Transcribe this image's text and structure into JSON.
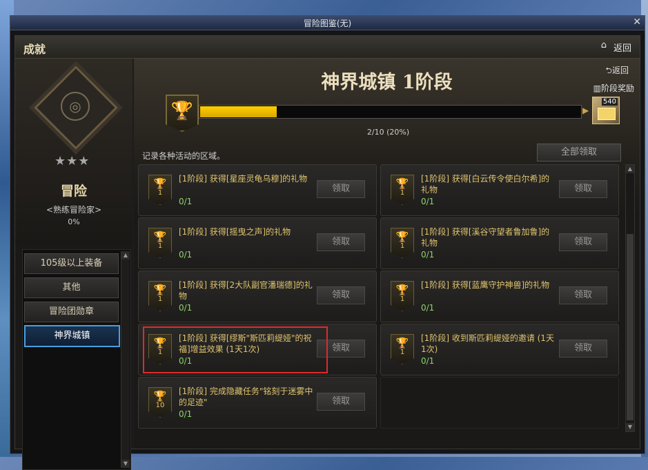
{
  "window": {
    "title": "冒险图鉴(无)",
    "close": "✕"
  },
  "header": {
    "title": "成就",
    "home": "⌂",
    "back": "返回"
  },
  "left": {
    "stars": "★★★",
    "name": "冒险",
    "rank": "<熟练冒险家>",
    "percent": "0%",
    "categories": [
      {
        "label": "105级以上装备",
        "active": false
      },
      {
        "label": "其他",
        "active": false
      },
      {
        "label": "冒险团勋章",
        "active": false
      },
      {
        "label": "神界城镇",
        "active": true
      }
    ]
  },
  "main": {
    "title": "神界城镇 1阶段",
    "return_label": "⮌返回",
    "stage_reward_label": "阶段奖励",
    "progress_text": "2/10 (20%)",
    "progress_fraction": 0.2,
    "reward_count": "540",
    "description": "记录各种活动的区域。",
    "claim_all": "全部领取",
    "cards": [
      {
        "text": "[1阶段] 获得[星座灵龟乌穆]的礼物",
        "progress": "0/1",
        "badge_num": "1",
        "button": "领取"
      },
      {
        "text": "[1阶段] 获得[白云传令使白尔希]的礼物",
        "progress": "0/1",
        "badge_num": "1",
        "button": "领取"
      },
      {
        "text": "[1阶段] 获得[摇曳之声]的礼物",
        "progress": "0/1",
        "badge_num": "1",
        "button": "领取"
      },
      {
        "text": "[1阶段] 获得[溪谷守望者鲁加鲁]的礼物",
        "progress": "0/1",
        "badge_num": "1",
        "button": "领取"
      },
      {
        "text": "[1阶段] 获得[2大队副官潘瑞德]的礼物",
        "progress": "0/1",
        "badge_num": "1",
        "button": "领取"
      },
      {
        "text": "[1阶段] 获得[蓝鹰守护神兽]的礼物",
        "progress": "0/1",
        "badge_num": "1",
        "button": "领取"
      },
      {
        "text": "[1阶段] 获得[缪斯\"斯匹莉缇娅\"的祝福]增益效果 (1天1次)",
        "progress": "0/1",
        "badge_num": "1",
        "button": "领取"
      },
      {
        "text": "[1阶段] 收到斯匹莉缇娅的邀请 (1天1次)",
        "progress": "0/1",
        "badge_num": "1",
        "button": "领取"
      },
      {
        "text": "[1阶段] 完成隐藏任务\"铭刻于迷雾中的足迹\"",
        "progress": "0/1",
        "badge_num": "10",
        "button": "领取"
      }
    ]
  },
  "colors": {
    "accent_gold": "#f0b800",
    "progress_green": "#8fd36a",
    "highlight_red": "#e02a2a",
    "active_blue": "#4aa0e0"
  }
}
